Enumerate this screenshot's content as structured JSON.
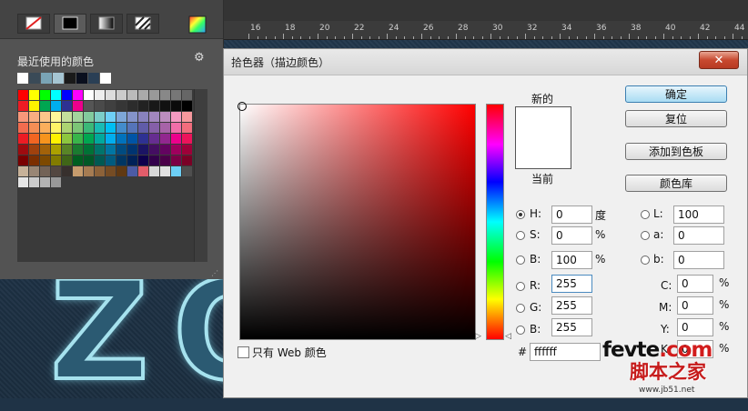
{
  "background_letters": [
    "Z",
    "O"
  ],
  "ruler": {
    "ticks": [
      "16",
      "18",
      "20",
      "22",
      "24",
      "26",
      "28",
      "30",
      "32",
      "34",
      "36",
      "38",
      "40",
      "42",
      "44"
    ]
  },
  "swatches_panel": {
    "title": "最近使用的颜色",
    "gear_icon": "gear-icon",
    "mode_buttons": [
      "no-color-icon",
      "black-fill-icon",
      "gradient-icon",
      "pattern-icon",
      "rainbow-icon"
    ],
    "recent_colors": [
      "#ffffff",
      "#3a4a57",
      "#7aa4b5",
      "#a5c5d2",
      "#1a1a1a",
      "#0a0f1e",
      "#2a3f55",
      "#ffffff"
    ],
    "grid_rows": [
      [
        "#ff0000",
        "#ffff00",
        "#00ff00",
        "#00ffff",
        "#0000ff",
        "#ff00ff",
        "#ffffff",
        "#eeeeee",
        "#dddddd",
        "#cccccc",
        "#bbbbbb",
        "#aaaaaa",
        "#999999",
        "#888888",
        "#777777",
        "#666666"
      ],
      [
        "#ed1c24",
        "#fff200",
        "#00a651",
        "#00aeef",
        "#2e3192",
        "#ec008c",
        "#555555",
        "#4a4a4a",
        "#404040",
        "#363636",
        "#2c2c2c",
        "#222222",
        "#181818",
        "#111111",
        "#0a0a0a",
        "#000000"
      ],
      [
        "#f7977a",
        "#f9ad81",
        "#fdc68a",
        "#fff79a",
        "#c4df9b",
        "#a3d39c",
        "#82ca9d",
        "#7bcdc8",
        "#6ecff6",
        "#7ea7d8",
        "#8493ca",
        "#8882be",
        "#a187be",
        "#bc8dbf",
        "#f49ac2",
        "#f6989d"
      ],
      [
        "#f26c4f",
        "#f68e55",
        "#fbaf5c",
        "#fff467",
        "#acd372",
        "#7cc576",
        "#3bb878",
        "#1abbb4",
        "#00bff3",
        "#438ccb",
        "#5574b9",
        "#605ca8",
        "#855fa8",
        "#a763a8",
        "#f06ea9",
        "#f26d7d"
      ],
      [
        "#ed1c24",
        "#f26522",
        "#f7941d",
        "#fff200",
        "#8dc73f",
        "#39b54a",
        "#00a651",
        "#00a99d",
        "#00aeef",
        "#0072bc",
        "#0054a6",
        "#2e3192",
        "#662d91",
        "#92278f",
        "#ec008c",
        "#ed145b"
      ],
      [
        "#9e0b0f",
        "#a0410d",
        "#a36209",
        "#aba000",
        "#598527",
        "#1a7b30",
        "#007236",
        "#00746b",
        "#0076a3",
        "#004b80",
        "#003471",
        "#1b1464",
        "#440e62",
        "#630460",
        "#9e005d",
        "#9e0039"
      ],
      [
        "#790000",
        "#7b2e00",
        "#7d4900",
        "#827b00",
        "#406618",
        "#005e20",
        "#005826",
        "#005952",
        "#005b7f",
        "#003663",
        "#002157",
        "#0d004c",
        "#32004b",
        "#4b0049",
        "#7b0046",
        "#7a0026"
      ],
      [
        "#c7b299",
        "#998675",
        "#736357",
        "#534741",
        "#37302d",
        "#c69c6d",
        "#a67c52",
        "#8c6239",
        "#754c24",
        "#603913",
        "#4c5ba5",
        "#e15d6a",
        "#d7d7d7",
        "#e1e1e1",
        "#6dcff6",
        "#4f4f4f"
      ],
      [
        "#e6e6e6",
        "#cccccc",
        "#b3b3b3",
        "#999999"
      ]
    ]
  },
  "dialog": {
    "title": "拾色器（描边颜色）",
    "close_label": "✕",
    "new_label": "新的",
    "current_label": "当前",
    "preview_color": "#ffffff",
    "buttons": {
      "ok": "确定",
      "reset": "复位",
      "add_swatch": "添加到色板",
      "libraries": "颜色库"
    },
    "hsb": [
      {
        "label": "H:",
        "value": "0",
        "unit": "度",
        "selected": true
      },
      {
        "label": "S:",
        "value": "0",
        "unit": "%",
        "selected": false
      },
      {
        "label": "B:",
        "value": "100",
        "unit": "%",
        "selected": false
      }
    ],
    "rgb": [
      {
        "label": "R:",
        "value": "255"
      },
      {
        "label": "G:",
        "value": "255"
      },
      {
        "label": "B:",
        "value": "255"
      }
    ],
    "lab": [
      {
        "label": "L:",
        "value": "100"
      },
      {
        "label": "a:",
        "value": "0"
      },
      {
        "label": "b:",
        "value": "0"
      }
    ],
    "cmyk": [
      {
        "label": "C:",
        "value": "0",
        "unit": "%"
      },
      {
        "label": "M:",
        "value": "0",
        "unit": "%"
      },
      {
        "label": "Y:",
        "value": "0",
        "unit": "%"
      },
      {
        "label": "K:",
        "value": "0",
        "unit": "%"
      }
    ],
    "hex_label": "#",
    "hex_value": "ffffff",
    "web_only_label": "只有 Web 颜色"
  },
  "watermark": {
    "site_pre": "fevte",
    "site_post": ".com",
    "cn": "脚本之家",
    "url": "www.jb51.net"
  }
}
